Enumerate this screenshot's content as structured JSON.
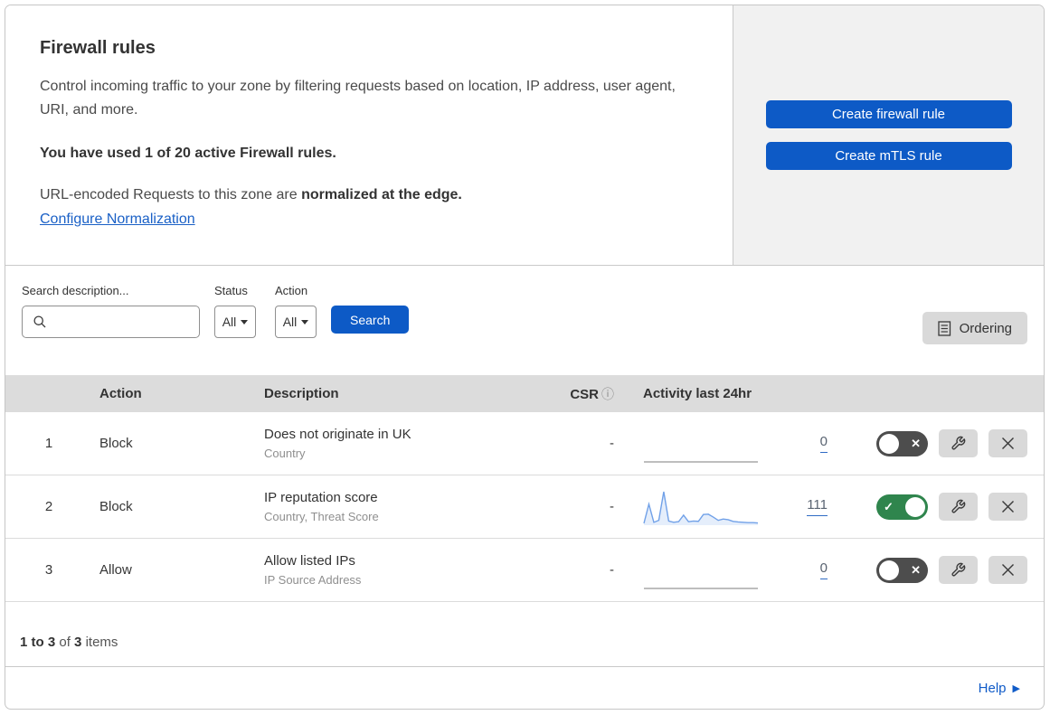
{
  "colors": {
    "primary_blue": "#0d5ac6",
    "link_blue": "#1a60c6",
    "toggle_on_green": "#2f854d",
    "toggle_off_gray": "#4d4d4d",
    "sparkline_blue": "#71a1e8",
    "sparkline_flat_gray": "#a8a8a8",
    "header_bg": "#dcdcdc",
    "panel_bg": "#f1f1f1",
    "icon_button_bg": "#d9d9d9"
  },
  "intro": {
    "title": "Firewall rules",
    "description": "Control incoming traffic to your zone by filtering requests based on location, IP address, user agent, URI, and more.",
    "usage": "You have used 1 of 20 active Firewall rules.",
    "normalization_prefix": "URL-encoded Requests to this zone are ",
    "normalization_bold": "normalized at the edge.",
    "normalization_link": "Configure Normalization"
  },
  "cta": {
    "create_firewall_rule": "Create firewall rule",
    "create_mtls_rule": "Create mTLS rule"
  },
  "filters": {
    "search_label": "Search description...",
    "status_label": "Status",
    "status_value": "All",
    "action_label": "Action",
    "action_value": "All",
    "search_button": "Search",
    "ordering_button": "Ordering"
  },
  "table": {
    "headers": {
      "action": "Action",
      "description": "Description",
      "csr": "CSR",
      "csr_info_icon": "ⓘ",
      "activity": "Activity last 24hr"
    },
    "rows": [
      {
        "number": "1",
        "action": "Block",
        "description": "Does not originate in UK",
        "fields": "Country",
        "csr": "-",
        "activity_count": "0",
        "enabled": false,
        "sparkline": [
          0,
          0,
          0,
          0,
          0,
          0,
          0,
          0,
          0,
          0,
          0,
          0
        ]
      },
      {
        "number": "2",
        "action": "Block",
        "description": "IP reputation score",
        "fields": "Country, Threat Score",
        "csr": "-",
        "activity_count": "111",
        "enabled": true,
        "sparkline": [
          3,
          62,
          6,
          12,
          100,
          10,
          6,
          8,
          28,
          8,
          10,
          9,
          30,
          31,
          22,
          12,
          16,
          14,
          9,
          7,
          6,
          5,
          5,
          4
        ]
      },
      {
        "number": "3",
        "action": "Allow",
        "description": "Allow listed IPs",
        "fields": "IP Source Address",
        "csr": "-",
        "activity_count": "0",
        "enabled": false,
        "sparkline": [
          0,
          0,
          0,
          0,
          0,
          0,
          0,
          0,
          0,
          0,
          0,
          0
        ]
      }
    ]
  },
  "footer": {
    "range": "1 to",
    "range_end": "3",
    "of_word": "of",
    "total": "3",
    "items_word": "items",
    "help": "Help"
  }
}
